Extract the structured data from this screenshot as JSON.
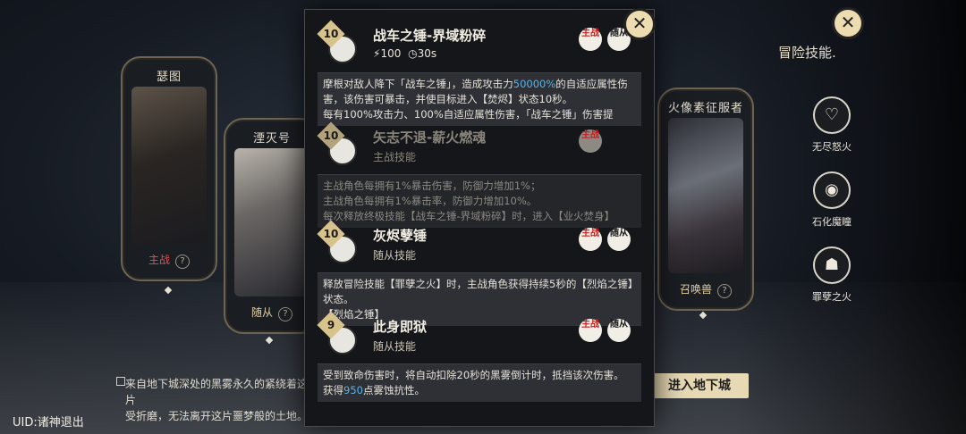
{
  "characters": [
    {
      "name": "瑟图",
      "tag": "主战"
    },
    {
      "name": "湮灭号",
      "tag": "随从"
    },
    {
      "name": "火像素征服者",
      "tag": "召唤兽"
    }
  ],
  "skills": [
    {
      "level": "10",
      "title": "战车之锤-界域粉碎",
      "cost": "100",
      "cooldown": "30s",
      "tags": [
        "主战",
        "随从"
      ],
      "desc": [
        "摩根对敌人降下「战车之锤」，造成攻击力",
        "50000%",
        "的自适应属性伤害，该伤害可暴击，并使目标进入【焚烬】状态10秒。",
        "每有100%攻击力、100%自适应属性伤害，「战车之锤」伤害提"
      ]
    },
    {
      "level": "10",
      "title": "矢志不退-薪火燃魂",
      "sub": "主战技能",
      "tags": [
        "主战"
      ],
      "desc": [
        "主战角色每拥有1%暴击伤害，防御力增加1%；",
        "主战角色每拥有1%暴击率，防御力增加10%。",
        "每次释放终极技能【战车之锤-界域粉碎】时，进入【业火焚身】"
      ]
    },
    {
      "level": "10",
      "title": "灰烬孽锤",
      "sub": "随从技能",
      "tags": [
        "主战",
        "随从"
      ],
      "desc": [
        "释放冒险技能【罪孽之火】时，主战角色获得持续5秒的【烈焰之锤】状态。",
        "【烈焰之锤】"
      ]
    },
    {
      "level": "9",
      "title": "此身即狱",
      "sub": "随从技能",
      "tags": [
        "主战",
        "随从"
      ],
      "desc": [
        "受到致命伤害时，将自动扣除20秒的黑雾倒计时，抵挡该次伤害。",
        "获得",
        "950",
        "点雾蚀抗性。"
      ]
    }
  ],
  "adventure": {
    "title": "冒险技能.",
    "items": [
      {
        "label": "无尽怒火",
        "icon": "heart-icon"
      },
      {
        "label": "石化魔瞳",
        "icon": "eye-icon"
      },
      {
        "label": "罪孽之火",
        "icon": "demon-icon"
      }
    ]
  },
  "enter_label": "进入地下城",
  "story": [
    "来自地下城深处的黑雾永久的紧绕着这片",
    "受折磨，无法离开这片噩梦般的土地。"
  ],
  "uid": "UID:诸神退出",
  "close_label": "✕"
}
